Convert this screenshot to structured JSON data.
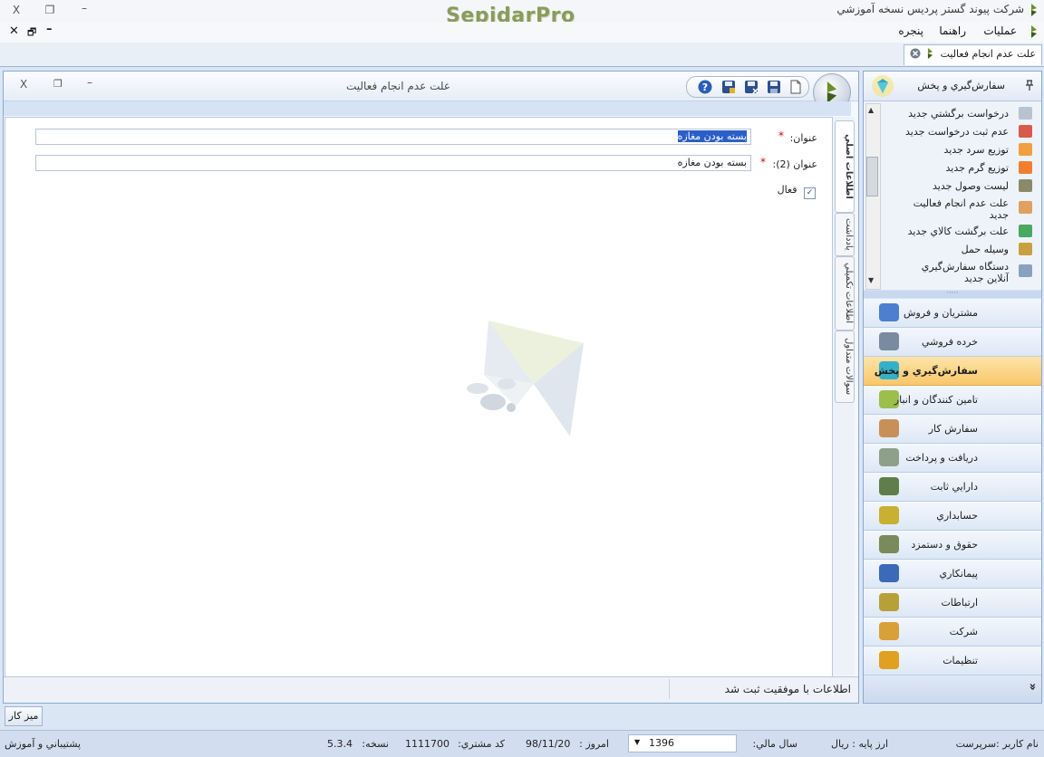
{
  "window": {
    "title": "شرکت پیوند گستر پردیس نسخه آموزشي",
    "brand": "SepidarPro",
    "buttons": {
      "close": "X",
      "restore": "❐",
      "minimize": "–"
    }
  },
  "menubar": {
    "items": [
      "عمليات",
      "راهنما",
      "پنجره"
    ],
    "mdi_buttons": {
      "close": "✕",
      "restore": "🗗",
      "minimize": "–"
    }
  },
  "doc_tab": {
    "label": "علت عدم انجام فعاليت"
  },
  "form": {
    "title": "علت عدم انجام فعاليت",
    "fields": [
      {
        "label": "عنوان:",
        "value": "بسته بودن مغازه",
        "required": true
      },
      {
        "label": "عنوان (2):",
        "value": "بسته بودن مغازه",
        "required": true
      }
    ],
    "active_checkbox": {
      "label": "فعال",
      "checked": true
    },
    "side_tabs": [
      "اطلاعات اصلي",
      "يادداشت",
      "اطلاعات تکميلي",
      "سوالات متداول"
    ],
    "status_message": "اطلاعات با موفقيت ثبت شد"
  },
  "nav": {
    "header": "سفارش‌گيري و پخش",
    "pin_icon": "pin-icon",
    "items": [
      {
        "label": "درخواست برگشتي جديد",
        "icon": "document-icon",
        "color": "#b8c3d2"
      },
      {
        "label": "عدم ثبت درخواست جديد",
        "icon": "document-block-icon",
        "color": "#d85a4a"
      },
      {
        "label": "توزيع سرد جديد",
        "icon": "truck-icon",
        "color": "#f0a040"
      },
      {
        "label": "توزيع گرم جديد",
        "icon": "truck-icon",
        "color": "#f08030"
      },
      {
        "label": "ليست وصول جديد",
        "icon": "list-icon",
        "color": "#8a8a6a"
      },
      {
        "label": "علت عدم انجام فعاليت جديد",
        "icon": "clipboard-icon",
        "color": "#e0a060"
      },
      {
        "label": "علت برگشت کالاي جديد",
        "icon": "cart-icon",
        "color": "#4aa860"
      },
      {
        "label": "وسيله حمل",
        "icon": "bus-icon",
        "color": "#c8a040"
      },
      {
        "label": "دستگاه سفارش‌گيري آنلاين جديد",
        "icon": "device-icon",
        "color": "#8aa0c0"
      }
    ],
    "modules": [
      {
        "label": "مشتريان و فروش",
        "icon": "chart-icon",
        "color": "#4c7fd0",
        "active": false
      },
      {
        "label": "خرده فروشي",
        "icon": "cart-icon",
        "color": "#7a8aa0",
        "active": false
      },
      {
        "label": "سفارش‌گيري و پخش",
        "icon": "gem-icon",
        "color": "#35b0c8",
        "active": true
      },
      {
        "label": "تامين کنندگان و انبار",
        "icon": "boxes-icon",
        "color": "#9cbf4c",
        "active": false
      },
      {
        "label": "سفارش کار",
        "icon": "parts-icon",
        "color": "#c89058",
        "active": false
      },
      {
        "label": "دريافت و پرداخت",
        "icon": "money-bag-icon",
        "color": "#8ea08a",
        "active": false
      },
      {
        "label": "دارايي ثابت",
        "icon": "truck-icon",
        "color": "#5f7f4a",
        "active": false
      },
      {
        "label": "حسابداري",
        "icon": "calculator-icon",
        "color": "#c8b030",
        "active": false
      },
      {
        "label": "حقوق و دستمزد",
        "icon": "coins-icon",
        "color": "#7a8a5a",
        "active": false
      },
      {
        "label": "پيمانکاري",
        "icon": "handshake-icon",
        "color": "#3a6ab8",
        "active": false
      },
      {
        "label": "ارتباطات",
        "icon": "phone-icon",
        "color": "#b8a038",
        "active": false
      },
      {
        "label": "شرکت",
        "icon": "company-icon",
        "color": "#d8a038",
        "active": false
      },
      {
        "label": "تنظيمات",
        "icon": "gear-icon",
        "color": "#e0a020",
        "active": false
      }
    ],
    "expand_label": "»"
  },
  "desktop_button": "ميز کار",
  "footer": {
    "user": "نام کاربر :سرپرست",
    "currency": "ارز پايه :   ريال",
    "fiscal_year_label": "سال مالي:",
    "fiscal_year": "1396",
    "today_label": "امروز :",
    "today": "98/11/20",
    "customer_code_label": "کد مشتري:",
    "customer_code": "1111700",
    "version_label": "نسخه:",
    "version": "5.3.4",
    "support": "پشتيباني و آموزش"
  }
}
